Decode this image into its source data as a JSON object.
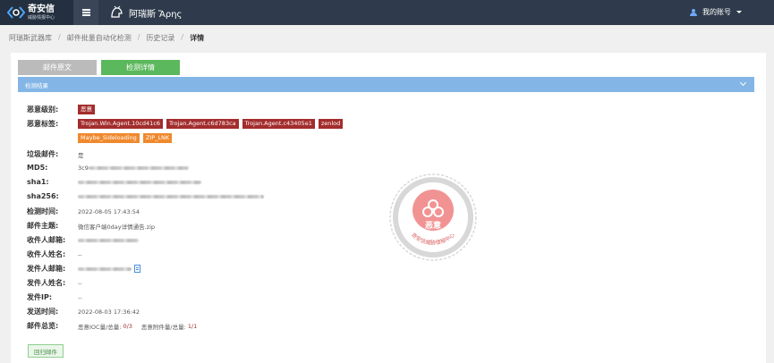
{
  "topbar": {
    "brand_name": "奇安信",
    "brand_subtitle": "威胁情报中心",
    "product_name": "阿瑞斯 Ἄρης",
    "account_label": "我的账号"
  },
  "breadcrumb": {
    "items": [
      "阿瑞斯武器库",
      "邮件批量自动化检测",
      "历史记录"
    ],
    "current": "详情"
  },
  "tabs": [
    {
      "label": "邮件原文",
      "active": false
    },
    {
      "label": "检测详情",
      "active": true
    }
  ],
  "section_title": "检测结果",
  "fields": {
    "severity": {
      "label": "恶意级别:",
      "value": "恶意"
    },
    "tags": {
      "label": "恶意标签:",
      "red": [
        "Trojan.Win.Agent.10cd41c6",
        "Trojan.Agent.c6d783ca",
        "Trojan.Agent.c43405e1",
        "zenlod"
      ],
      "orange": [
        "Maybe_Sideloading",
        "ZIP_LNK"
      ]
    },
    "spam": {
      "label": "垃圾邮件:",
      "value": "是"
    },
    "md5": {
      "label": "MD5:",
      "value": "3c9"
    },
    "sha1": {
      "label": "sha1:"
    },
    "sha256": {
      "label": "sha256:"
    },
    "detect_time": {
      "label": "检测时间:",
      "value": "2022-08-05 17:43:54"
    },
    "subject": {
      "label": "邮件主题:",
      "value": "微信客户端0day详情通告.zip"
    },
    "recipient_email": {
      "label": "收件人邮箱:"
    },
    "recipient_name": {
      "label": "收件人姓名:",
      "value": "--"
    },
    "sender_email": {
      "label": "发件人邮箱:"
    },
    "sender_name": {
      "label": "发件人姓名:",
      "value": "--"
    },
    "sender_ip": {
      "label": "发件IP:",
      "value": "--"
    },
    "send_time": {
      "label": "发送时间:",
      "value": "2022-08-03 17:36:42"
    },
    "overview": {
      "label": "邮件总览:",
      "ioc_label": "恶意IOC量/总量:",
      "ioc_value": "0/3",
      "attach_label": "恶意附件量/总量:",
      "attach_value": "1/1"
    }
  },
  "stamp": {
    "verdict": "恶意",
    "org_text": "奇安信威胁情报中心"
  },
  "return_button": "回归邮件",
  "colors": {
    "topbar": "#2f3b4c",
    "section_bar": "#83b6e6",
    "tab_active": "#5cb85c",
    "tag_red": "#a32d2d",
    "tag_orange": "#f0892e"
  }
}
